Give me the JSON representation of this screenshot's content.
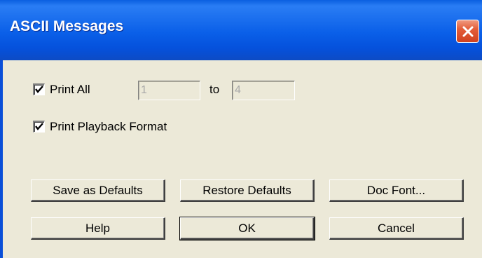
{
  "window": {
    "title": "ASCII Messages"
  },
  "print_all": {
    "label": "Print All",
    "checked": true,
    "from_value": "1",
    "to_label": "to",
    "to_value": "4"
  },
  "playback": {
    "label": "Print Playback Format",
    "checked": true
  },
  "buttons": {
    "save_defaults": "Save as Defaults",
    "restore_defaults": "Restore Defaults",
    "doc_font": "Doc Font...",
    "help": "Help",
    "ok": "OK",
    "cancel": "Cancel"
  },
  "icons": {
    "close": "close-icon",
    "check": "checkmark-icon"
  },
  "colors": {
    "titlebar": "#0a5fe0",
    "close_button": "#e35e3a",
    "dialog_bg": "#ece9d8"
  }
}
